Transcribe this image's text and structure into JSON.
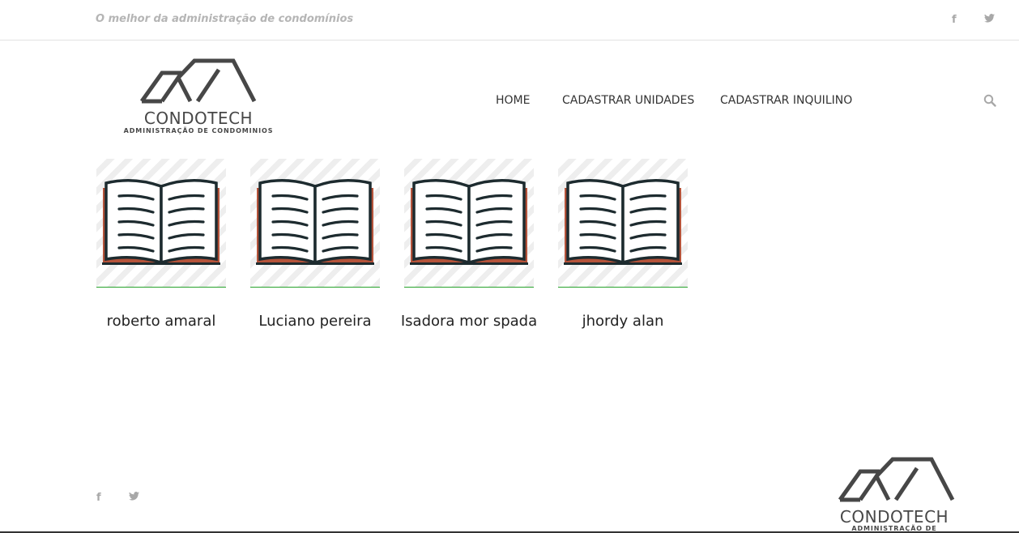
{
  "topbar": {
    "tagline": "O melhor da administração de condomínios",
    "facebook_glyph": "f"
  },
  "brand": {
    "name": "CONDOTECH",
    "subtitle": "ADMINISTRAÇÃO DE CONDOMINIOS"
  },
  "nav": {
    "items": [
      {
        "label": "HOME"
      },
      {
        "label": "CADASTRAR UNIDADES"
      },
      {
        "label": "CADASTRAR INQUILINO"
      }
    ],
    "search_icon": "search-icon"
  },
  "tenants": [
    {
      "name": "roberto amaral",
      "icon": "open-book-icon"
    },
    {
      "name": "Luciano pereira",
      "icon": "open-book-icon"
    },
    {
      "name": "Isadora mor spada",
      "icon": "open-book-icon"
    },
    {
      "name": "jhordy alan",
      "icon": "open-book-icon"
    }
  ],
  "footer": {
    "facebook_glyph": "f",
    "brand_name": "CONDOTECH",
    "brand_subtitle": "ADMINISTRAÇÃO DE CONDOMINIOS"
  },
  "colors": {
    "accent_green": "#27a22c",
    "logo_gray": "#474747",
    "book_dark": "#1d2b2f",
    "book_edge": "#b5533a"
  }
}
